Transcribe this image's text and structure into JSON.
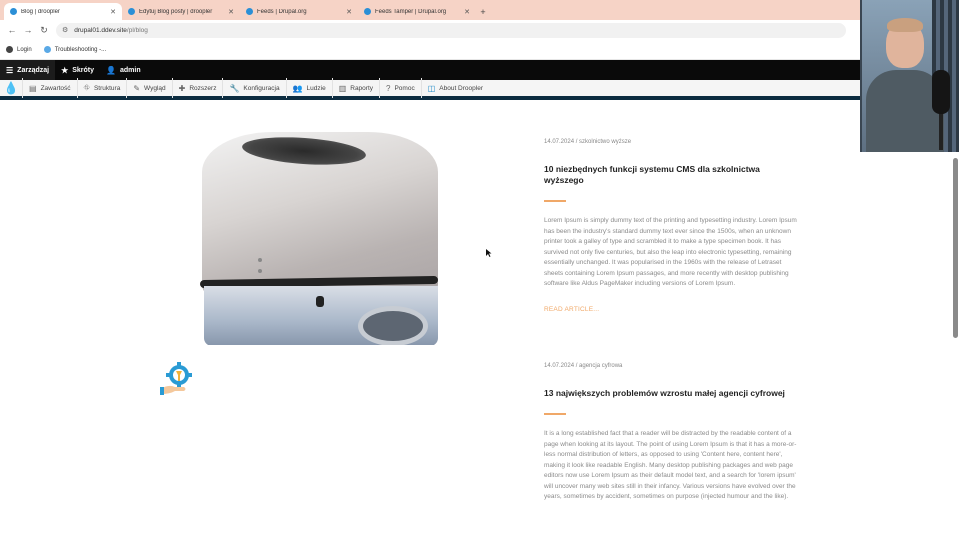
{
  "browser": {
    "tabs": [
      {
        "label": "Blog | droopler",
        "active": true
      },
      {
        "label": "Edytuj Blog posty | droopler",
        "active": false
      },
      {
        "label": "Feeds | Drupal.org",
        "active": false
      },
      {
        "label": "Feeds Tamper | Drupal.org",
        "active": false
      }
    ],
    "new_tab": "+",
    "url_host": "drupal01.ddev.site",
    "url_path": "/pl/blog",
    "bookmarks": [
      {
        "label": "Login",
        "color": "#444444"
      },
      {
        "label": "Troubleshooting -...",
        "color": "#5aa9e6"
      }
    ]
  },
  "toolbar": {
    "manage": "Zarządzaj",
    "shortcuts": "Skróty",
    "user": "admin"
  },
  "admin_menu": {
    "items": [
      {
        "label": "Zawartość",
        "icon": "content-icon"
      },
      {
        "label": "Struktura",
        "icon": "structure-icon"
      },
      {
        "label": "Wygląd",
        "icon": "appearance-icon"
      },
      {
        "label": "Rozszerz",
        "icon": "extend-icon"
      },
      {
        "label": "Konfiguracja",
        "icon": "config-icon"
      },
      {
        "label": "Ludzie",
        "icon": "people-icon"
      },
      {
        "label": "Raporty",
        "icon": "reports-icon"
      },
      {
        "label": "Pomoc",
        "icon": "help-icon"
      },
      {
        "label": "About Droopler",
        "icon": "droopler-icon"
      }
    ]
  },
  "articles": [
    {
      "meta": "14.07.2024 / szkolnictwo wyższe",
      "title": "10 niezbędnych funkcji systemu CMS dla szkolnictwa wyższego",
      "body": "Lorem Ipsum is simply dummy text of the printing and typesetting industry. Lorem Ipsum has been the industry's standard dummy text ever since the 1500s, when an unknown printer took a galley of type and scrambled it to make a type specimen book. It has survived not only five centuries, but also the leap into electronic typesetting, remaining essentially unchanged. It was popularised in the 1960s with the release of Letraset sheets containing Lorem Ipsum passages, and more recently with desktop publishing software like Aldus PageMaker including versions of Lorem Ipsum.",
      "read_more": "READ ARTICLE..."
    },
    {
      "meta": "14.07.2024 / agencja cyfrowa",
      "title": "13 największych problemów wzrostu małej agencji cyfrowej",
      "body": "It is a long established fact that a reader will be distracted by the readable content of a page when looking at its layout. The point of using Lorem Ipsum is that it has a more-or-less normal distribution of letters, as opposed to using 'Content here, content here', making it look like readable English. Many desktop publishing packages and web page editors now use Lorem Ipsum as their default model text, and a search for 'lorem ipsum' will uncover many web sites still in their infancy. Various versions have evolved over the years, sometimes by accident, sometimes on purpose (injected humour and the like)."
    }
  ],
  "colors": {
    "accent": "#f0a868",
    "drupal_blue": "#1b89c8",
    "tabbar": "#f6d3c6",
    "toolbar": "#0a0a0a"
  }
}
